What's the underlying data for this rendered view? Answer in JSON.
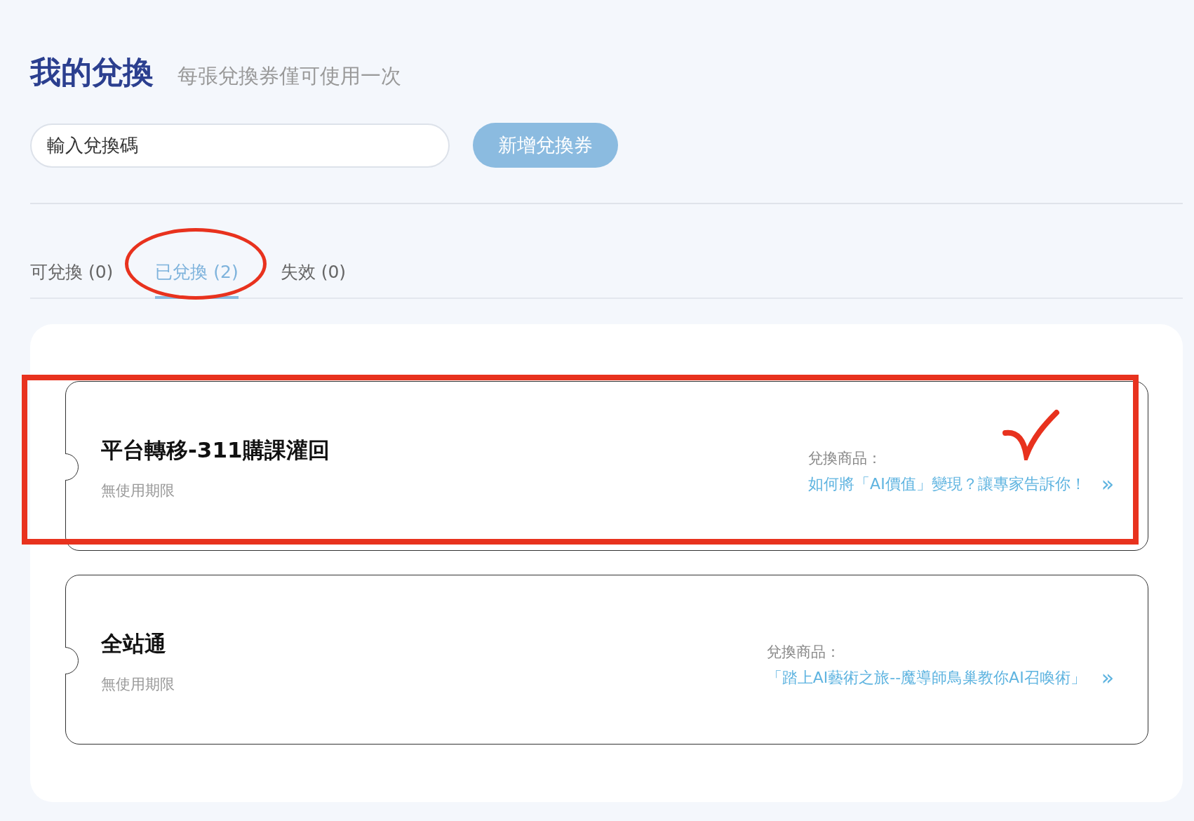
{
  "header": {
    "title": "我的兌換",
    "subtitle": "每張兌換券僅可使用一次"
  },
  "redeem": {
    "placeholder": "輸入兌換碼",
    "button": "新增兌換券"
  },
  "tabs": [
    {
      "label": "可兌換 (0)",
      "selected": false,
      "circled": false
    },
    {
      "label": "已兌換 (2)",
      "selected": true,
      "circled": true
    },
    {
      "label": "失效 (0)",
      "selected": false,
      "circled": false
    }
  ],
  "tickets": [
    {
      "title": "平台轉移-311購課灌回",
      "validity": "無使用期限",
      "product_label": "兌換商品：",
      "product": "如何將「AI價值」變現？讓專家告訴你！",
      "chevron": "»",
      "boxed": true,
      "ticked": true
    },
    {
      "title": "全站通",
      "validity": "無使用期限",
      "product_label": "兌換商品：",
      "product": "「踏上AI藝術之旅--魔導師鳥巢教你AI召喚術」",
      "chevron": "»",
      "boxed": false,
      "ticked": false
    }
  ]
}
